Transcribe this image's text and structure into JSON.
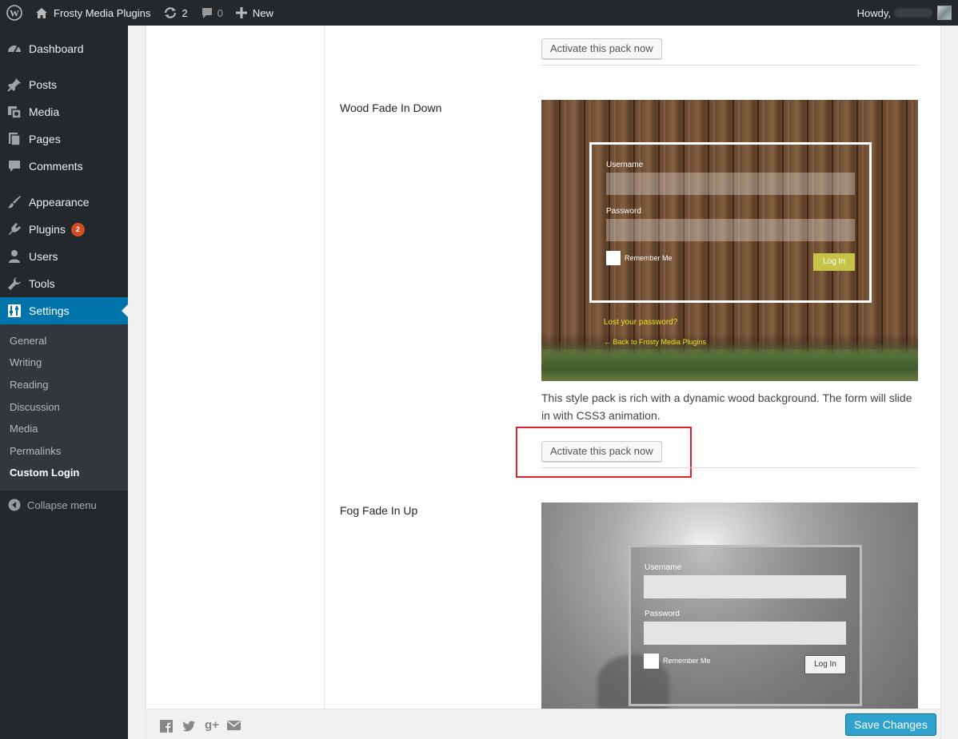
{
  "adminbar": {
    "site_name": "Frosty Media Plugins",
    "updates_count": "2",
    "comments_count": "0",
    "new_label": "New",
    "howdy": "Howdy,"
  },
  "sidebar": {
    "items": [
      {
        "label": "Dashboard",
        "icon": "dashboard-icon"
      },
      {
        "label": "Posts",
        "icon": "pin-icon"
      },
      {
        "label": "Media",
        "icon": "media-icon"
      },
      {
        "label": "Pages",
        "icon": "pages-icon"
      },
      {
        "label": "Comments",
        "icon": "comments-icon"
      },
      {
        "label": "Appearance",
        "icon": "brush-icon"
      },
      {
        "label": "Plugins",
        "icon": "plugin-icon",
        "badge": "2"
      },
      {
        "label": "Users",
        "icon": "users-icon"
      },
      {
        "label": "Tools",
        "icon": "wrench-icon"
      },
      {
        "label": "Settings",
        "icon": "settings-icon",
        "current": true
      }
    ],
    "submenu": [
      "General",
      "Writing",
      "Reading",
      "Discussion",
      "Media",
      "Permalinks",
      "Custom Login"
    ],
    "collapse_label": "Collapse menu"
  },
  "content": {
    "activate_label": "Activate this pack now",
    "packs": [
      {
        "title": "Wood Fade In Down",
        "description": "This style pack is rich with a dynamic wood background. The form will slide in with CSS3 animation.",
        "preview": {
          "username_label": "Username",
          "password_label": "Password",
          "remember_label": "Remember Me",
          "login_label": "Log In",
          "lost_password": "Lost your password?",
          "back_link": "← Back to Frosty Media Plugins"
        }
      },
      {
        "title": "Fog Fade In Up",
        "preview": {
          "username_label": "Username",
          "password_label": "Password",
          "remember_label": "Remember Me",
          "login_label": "Log In"
        }
      }
    ]
  },
  "footer": {
    "social_icons": [
      "facebook-icon",
      "twitter-icon",
      "google-plus-icon",
      "email-icon"
    ],
    "save_label": "Save Changes"
  },
  "colors": {
    "admin_bar": "#23282d",
    "menu_current": "#0073aa",
    "save_button": "#2ea2cc",
    "highlight": "#e0202a",
    "link_yellow": "#e8e21d"
  }
}
